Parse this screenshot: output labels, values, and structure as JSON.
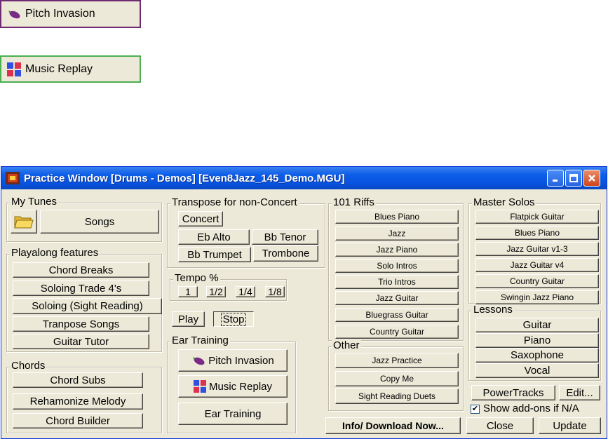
{
  "top_buttons": {
    "pitch_invasion": "Pitch Invasion",
    "music_replay": "Music Replay"
  },
  "window": {
    "title": "Practice Window  [Drums - Demos]  [Even8Jazz_145_Demo.MGU]"
  },
  "my_tunes": {
    "label": "My Tunes",
    "songs": "Songs"
  },
  "playalong": {
    "label": "Playalong features",
    "items": [
      "Chord Breaks",
      "Soloing Trade 4's",
      "Soloing (Sight Reading)",
      "Tranpose Songs",
      "Guitar Tutor"
    ]
  },
  "chords": {
    "label": "Chords",
    "items": [
      "Chord Subs",
      "Rehamonize Melody",
      "Chord Builder"
    ]
  },
  "transpose": {
    "label": "Transpose for non-Concert",
    "concert": "Concert",
    "eb_alto": "Eb Alto",
    "bb_tenor": "Bb Tenor",
    "bb_trumpet": "Bb Trumpet",
    "trombone": "Trombone"
  },
  "tempo": {
    "label": "Tempo %",
    "items": [
      "1",
      "1/2",
      "1/4",
      "1/8"
    ]
  },
  "playback": {
    "play": "Play",
    "stop": "Stop"
  },
  "ear_training": {
    "label": "Ear Training",
    "pitch_invasion": "Pitch Invasion",
    "music_replay": "Music Replay",
    "ear_training": "Ear Training"
  },
  "riffs": {
    "label": "101 Riffs",
    "items": [
      "Blues Piano",
      "Jazz",
      "Jazz Piano",
      "Solo Intros",
      "Trio Intros",
      "Jazz Guitar",
      "Bluegrass Guitar",
      "Country Guitar"
    ]
  },
  "other": {
    "label": "Other",
    "items": [
      "Jazz Practice",
      "Copy Me",
      "Sight Reading Duets"
    ]
  },
  "info_download": "Info/ Download Now...",
  "master_solos": {
    "label": "Master Solos",
    "items": [
      "Flatpick Guitar",
      "Blues Piano",
      "Jazz Guitar v1-3",
      "Jazz Guitar v4",
      "Country Guitar",
      "Swingin Jazz Piano"
    ]
  },
  "lessons": {
    "label": "Lessons",
    "items": [
      "Guitar",
      "Piano",
      "Saxophone",
      "Vocal"
    ]
  },
  "footer": {
    "powertracks": "PowerTracks",
    "edit": "Edit...",
    "show_addons": "Show add-ons if N/A",
    "show_addons_checked": true,
    "close": "Close",
    "update": "Update"
  },
  "colors": {
    "title_blue": "#0854e0",
    "face": "#ece9d8",
    "pitch_border": "#6e2b72",
    "replay_border": "#4caf50"
  }
}
